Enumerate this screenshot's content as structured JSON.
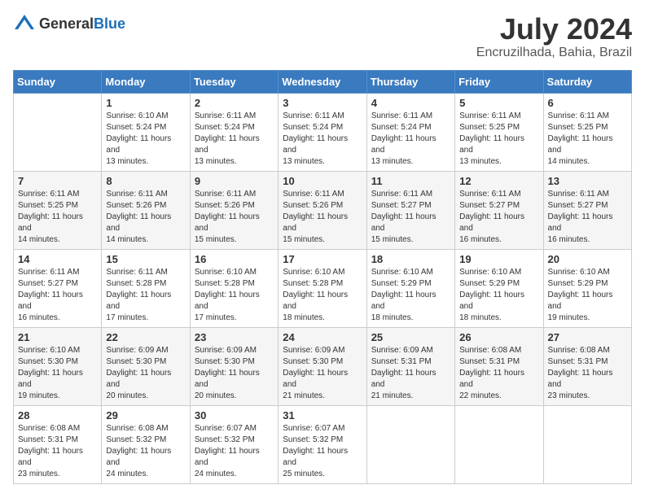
{
  "logo": {
    "general": "General",
    "blue": "Blue"
  },
  "title": "July 2024",
  "location": "Encruzilhada, Bahia, Brazil",
  "weekdays": [
    "Sunday",
    "Monday",
    "Tuesday",
    "Wednesday",
    "Thursday",
    "Friday",
    "Saturday"
  ],
  "weeks": [
    [
      {
        "day": "",
        "sunrise": "",
        "sunset": "",
        "daylight": ""
      },
      {
        "day": "1",
        "sunrise": "Sunrise: 6:10 AM",
        "sunset": "Sunset: 5:24 PM",
        "daylight": "Daylight: 11 hours and 13 minutes."
      },
      {
        "day": "2",
        "sunrise": "Sunrise: 6:11 AM",
        "sunset": "Sunset: 5:24 PM",
        "daylight": "Daylight: 11 hours and 13 minutes."
      },
      {
        "day": "3",
        "sunrise": "Sunrise: 6:11 AM",
        "sunset": "Sunset: 5:24 PM",
        "daylight": "Daylight: 11 hours and 13 minutes."
      },
      {
        "day": "4",
        "sunrise": "Sunrise: 6:11 AM",
        "sunset": "Sunset: 5:24 PM",
        "daylight": "Daylight: 11 hours and 13 minutes."
      },
      {
        "day": "5",
        "sunrise": "Sunrise: 6:11 AM",
        "sunset": "Sunset: 5:25 PM",
        "daylight": "Daylight: 11 hours and 13 minutes."
      },
      {
        "day": "6",
        "sunrise": "Sunrise: 6:11 AM",
        "sunset": "Sunset: 5:25 PM",
        "daylight": "Daylight: 11 hours and 14 minutes."
      }
    ],
    [
      {
        "day": "7",
        "sunrise": "Sunrise: 6:11 AM",
        "sunset": "Sunset: 5:25 PM",
        "daylight": "Daylight: 11 hours and 14 minutes."
      },
      {
        "day": "8",
        "sunrise": "Sunrise: 6:11 AM",
        "sunset": "Sunset: 5:26 PM",
        "daylight": "Daylight: 11 hours and 14 minutes."
      },
      {
        "day": "9",
        "sunrise": "Sunrise: 6:11 AM",
        "sunset": "Sunset: 5:26 PM",
        "daylight": "Daylight: 11 hours and 15 minutes."
      },
      {
        "day": "10",
        "sunrise": "Sunrise: 6:11 AM",
        "sunset": "Sunset: 5:26 PM",
        "daylight": "Daylight: 11 hours and 15 minutes."
      },
      {
        "day": "11",
        "sunrise": "Sunrise: 6:11 AM",
        "sunset": "Sunset: 5:27 PM",
        "daylight": "Daylight: 11 hours and 15 minutes."
      },
      {
        "day": "12",
        "sunrise": "Sunrise: 6:11 AM",
        "sunset": "Sunset: 5:27 PM",
        "daylight": "Daylight: 11 hours and 16 minutes."
      },
      {
        "day": "13",
        "sunrise": "Sunrise: 6:11 AM",
        "sunset": "Sunset: 5:27 PM",
        "daylight": "Daylight: 11 hours and 16 minutes."
      }
    ],
    [
      {
        "day": "14",
        "sunrise": "Sunrise: 6:11 AM",
        "sunset": "Sunset: 5:27 PM",
        "daylight": "Daylight: 11 hours and 16 minutes."
      },
      {
        "day": "15",
        "sunrise": "Sunrise: 6:11 AM",
        "sunset": "Sunset: 5:28 PM",
        "daylight": "Daylight: 11 hours and 17 minutes."
      },
      {
        "day": "16",
        "sunrise": "Sunrise: 6:10 AM",
        "sunset": "Sunset: 5:28 PM",
        "daylight": "Daylight: 11 hours and 17 minutes."
      },
      {
        "day": "17",
        "sunrise": "Sunrise: 6:10 AM",
        "sunset": "Sunset: 5:28 PM",
        "daylight": "Daylight: 11 hours and 18 minutes."
      },
      {
        "day": "18",
        "sunrise": "Sunrise: 6:10 AM",
        "sunset": "Sunset: 5:29 PM",
        "daylight": "Daylight: 11 hours and 18 minutes."
      },
      {
        "day": "19",
        "sunrise": "Sunrise: 6:10 AM",
        "sunset": "Sunset: 5:29 PM",
        "daylight": "Daylight: 11 hours and 18 minutes."
      },
      {
        "day": "20",
        "sunrise": "Sunrise: 6:10 AM",
        "sunset": "Sunset: 5:29 PM",
        "daylight": "Daylight: 11 hours and 19 minutes."
      }
    ],
    [
      {
        "day": "21",
        "sunrise": "Sunrise: 6:10 AM",
        "sunset": "Sunset: 5:30 PM",
        "daylight": "Daylight: 11 hours and 19 minutes."
      },
      {
        "day": "22",
        "sunrise": "Sunrise: 6:09 AM",
        "sunset": "Sunset: 5:30 PM",
        "daylight": "Daylight: 11 hours and 20 minutes."
      },
      {
        "day": "23",
        "sunrise": "Sunrise: 6:09 AM",
        "sunset": "Sunset: 5:30 PM",
        "daylight": "Daylight: 11 hours and 20 minutes."
      },
      {
        "day": "24",
        "sunrise": "Sunrise: 6:09 AM",
        "sunset": "Sunset: 5:30 PM",
        "daylight": "Daylight: 11 hours and 21 minutes."
      },
      {
        "day": "25",
        "sunrise": "Sunrise: 6:09 AM",
        "sunset": "Sunset: 5:31 PM",
        "daylight": "Daylight: 11 hours and 21 minutes."
      },
      {
        "day": "26",
        "sunrise": "Sunrise: 6:08 AM",
        "sunset": "Sunset: 5:31 PM",
        "daylight": "Daylight: 11 hours and 22 minutes."
      },
      {
        "day": "27",
        "sunrise": "Sunrise: 6:08 AM",
        "sunset": "Sunset: 5:31 PM",
        "daylight": "Daylight: 11 hours and 23 minutes."
      }
    ],
    [
      {
        "day": "28",
        "sunrise": "Sunrise: 6:08 AM",
        "sunset": "Sunset: 5:31 PM",
        "daylight": "Daylight: 11 hours and 23 minutes."
      },
      {
        "day": "29",
        "sunrise": "Sunrise: 6:08 AM",
        "sunset": "Sunset: 5:32 PM",
        "daylight": "Daylight: 11 hours and 24 minutes."
      },
      {
        "day": "30",
        "sunrise": "Sunrise: 6:07 AM",
        "sunset": "Sunset: 5:32 PM",
        "daylight": "Daylight: 11 hours and 24 minutes."
      },
      {
        "day": "31",
        "sunrise": "Sunrise: 6:07 AM",
        "sunset": "Sunset: 5:32 PM",
        "daylight": "Daylight: 11 hours and 25 minutes."
      },
      {
        "day": "",
        "sunrise": "",
        "sunset": "",
        "daylight": ""
      },
      {
        "day": "",
        "sunrise": "",
        "sunset": "",
        "daylight": ""
      },
      {
        "day": "",
        "sunrise": "",
        "sunset": "",
        "daylight": ""
      }
    ]
  ]
}
